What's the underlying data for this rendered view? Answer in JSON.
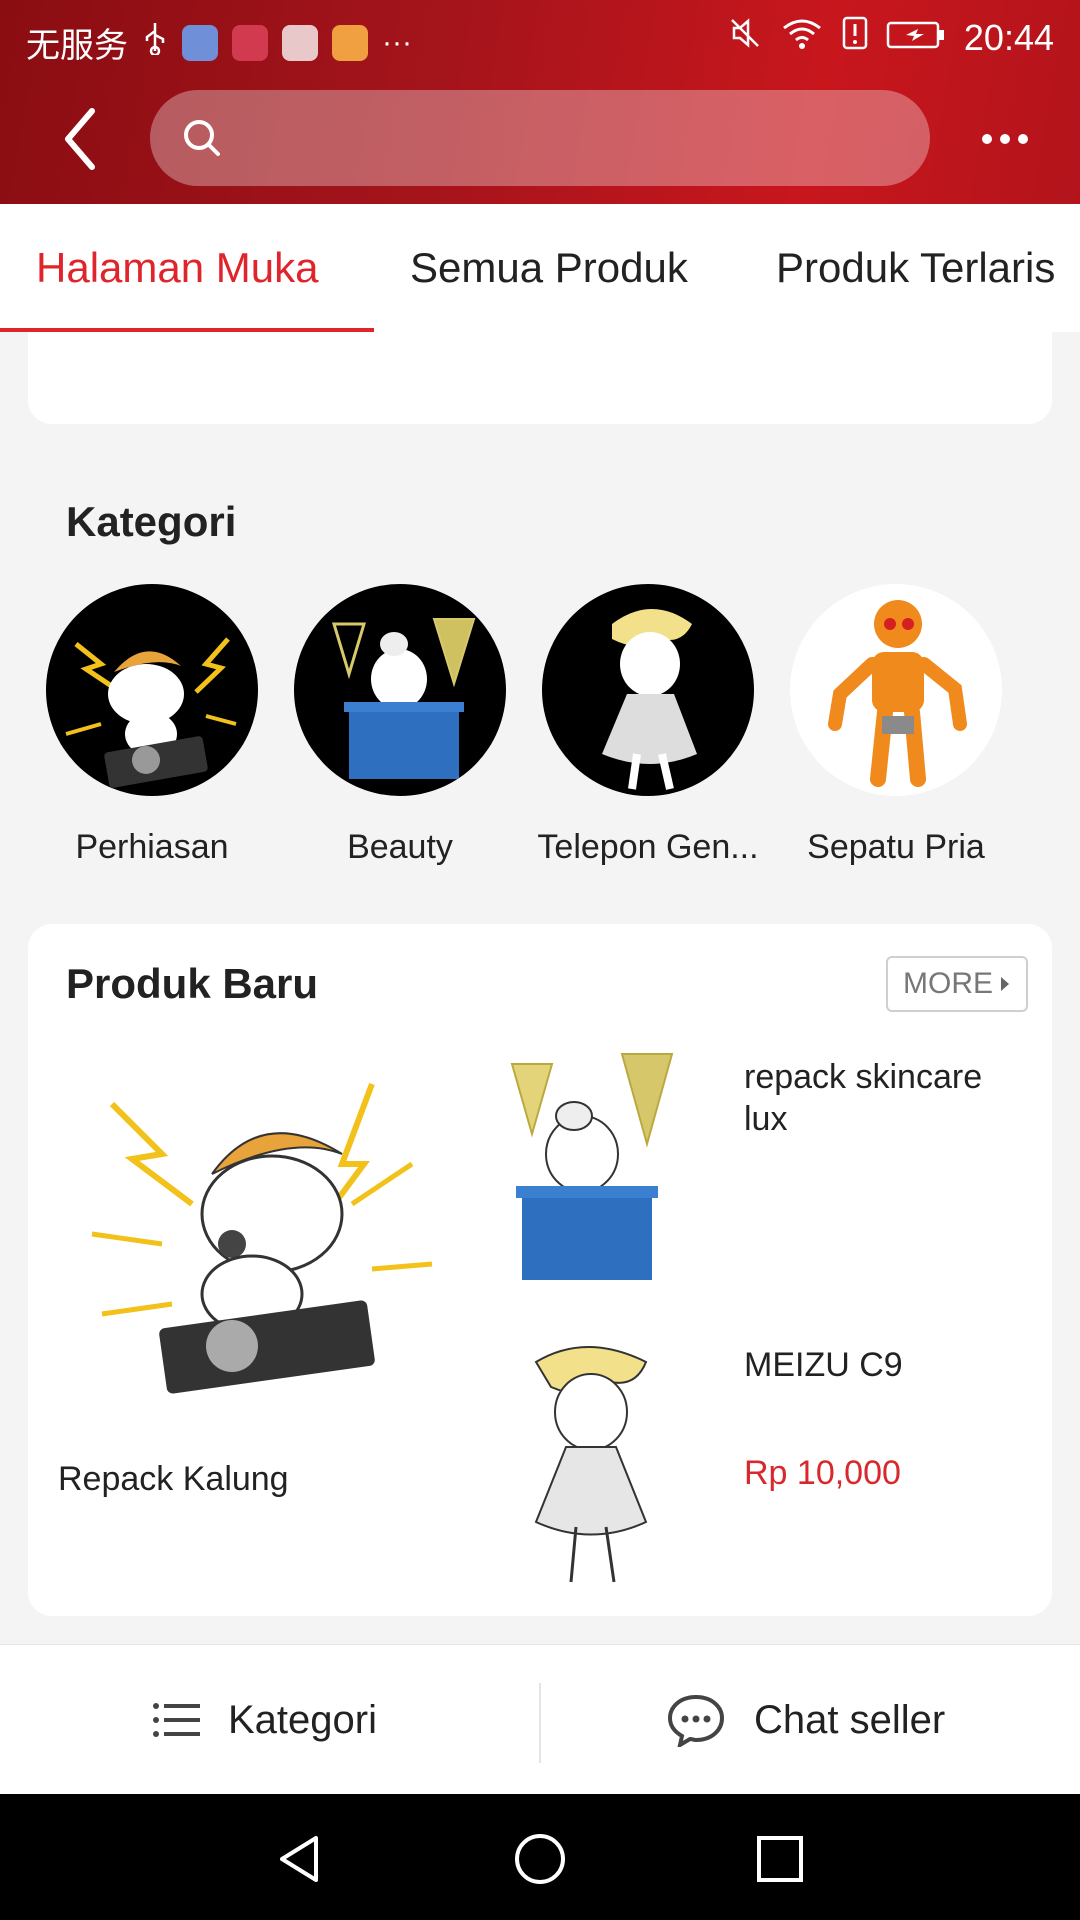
{
  "status_bar": {
    "carrier": "无服务",
    "time": "20:44",
    "icons": [
      "usb-icon",
      "browser-app-icon",
      "shop-app-icon",
      "fm-app-icon",
      "media-app-icon",
      "overflow-dots-icon",
      "mute-icon",
      "wifi-icon",
      "alert-icon",
      "battery-icon"
    ]
  },
  "header": {
    "search_placeholder": "",
    "colors": {
      "bg_dark": "#8a0d12",
      "bg_light": "#c8161d"
    }
  },
  "tabs": [
    {
      "label": "Halaman Muka",
      "active": true
    },
    {
      "label": "Semua Produk",
      "active": false
    },
    {
      "label": "Produk Terlaris",
      "active": false
    }
  ],
  "kategori": {
    "title": "Kategori",
    "items": [
      {
        "label": "Perhiasan",
        "image": "dj-unicorn"
      },
      {
        "label": "Beauty",
        "image": "chandelier-unicorn"
      },
      {
        "label": "Telepon Gen...",
        "image": "dress-unicorn"
      },
      {
        "label": "Sepatu Pria",
        "image": "orange-robot"
      }
    ]
  },
  "produk_baru": {
    "title": "Produk Baru",
    "more_label": "MORE",
    "featured": {
      "name": "Repack Kalung",
      "image": "dj-unicorn"
    },
    "items": [
      {
        "name": "repack skincare lux",
        "image": "chandelier-unicorn",
        "price": ""
      },
      {
        "name": "MEIZU C9",
        "image": "dress-unicorn",
        "price": "Rp 10,000"
      }
    ]
  },
  "bottom_bar": {
    "kategori_label": "Kategori",
    "chat_label": "Chat seller"
  },
  "accent_color": "#e0242b"
}
